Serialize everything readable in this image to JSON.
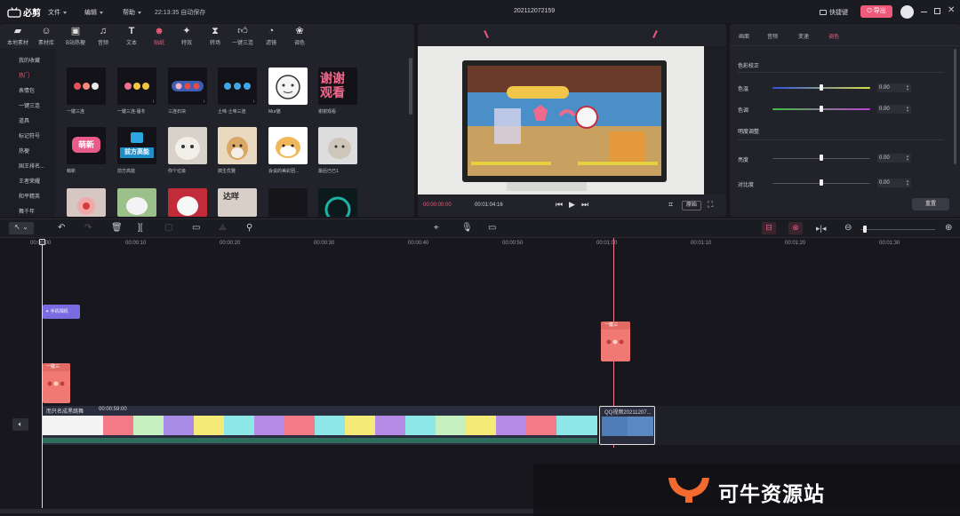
{
  "app": {
    "logo_text": "必剪",
    "title": "202112072159",
    "autosave": "22:13:35 自动保存",
    "shortcut": "快捷键",
    "export": "导出"
  },
  "menu": [
    {
      "label": "文件"
    },
    {
      "label": "编辑"
    },
    {
      "label": "帮助"
    }
  ],
  "tabs": [
    {
      "label": "本地素材",
      "icon": "folder-icon"
    },
    {
      "label": "素材库",
      "icon": "smile-icon"
    },
    {
      "label": "B站热梗",
      "icon": "tv-icon"
    },
    {
      "label": "音频",
      "icon": "music-icon"
    },
    {
      "label": "文本",
      "icon": "text-icon"
    },
    {
      "label": "贴纸",
      "icon": "sticker-icon"
    },
    {
      "label": "特效",
      "icon": "sparkle-icon"
    },
    {
      "label": "转场",
      "icon": "transition-icon"
    },
    {
      "label": "一键三连",
      "icon": "thumb-icon"
    },
    {
      "label": "滤镜",
      "icon": "filter-icon"
    },
    {
      "label": "调色",
      "icon": "color-icon"
    }
  ],
  "categories": [
    {
      "label": "我的收藏"
    },
    {
      "label": "热门"
    },
    {
      "label": "表情包"
    },
    {
      "label": "一键三连"
    },
    {
      "label": "道具"
    },
    {
      "label": "标记符号"
    },
    {
      "label": "热梗"
    },
    {
      "label": "国王排名..."
    },
    {
      "label": "王者荣耀"
    },
    {
      "label": "和平精英"
    },
    {
      "label": "舞千年"
    }
  ],
  "stickers": [
    {
      "label": "一键三连"
    },
    {
      "label": "一键三连-履冬"
    },
    {
      "label": "三连石块"
    },
    {
      "label": "土味-土味三连"
    },
    {
      "label": "Mur猫"
    },
    {
      "label": "谢谢观看"
    },
    {
      "label": "萌新"
    },
    {
      "label": "前方高能"
    },
    {
      "label": "你个垃圾"
    },
    {
      "label": "搞生优雅"
    },
    {
      "label": "会说的美彩团..."
    },
    {
      "label": "最后已已1"
    },
    {
      "label": ""
    },
    {
      "label": ""
    },
    {
      "label": ""
    },
    {
      "label": ""
    },
    {
      "label": ""
    },
    {
      "label": ""
    }
  ],
  "sticker_texts": {
    "thanks_line1": "谢谢",
    "thanks_line2": "观看",
    "cute": "萌新",
    "high": "前方高能",
    "dash": "达咩"
  },
  "preview": {
    "current_time": "00:00:00:00",
    "total_time": "00:01:04:16",
    "ratio_button": "原始"
  },
  "props": {
    "tabs": [
      {
        "label": "画面"
      },
      {
        "label": "音频"
      },
      {
        "label": "变速"
      },
      {
        "label": "调色"
      }
    ],
    "section1": "色彩校正",
    "section2": "明度调整",
    "rows": [
      {
        "label": "色温",
        "value": "0.00"
      },
      {
        "label": "色调",
        "value": "0.00"
      },
      {
        "label": "亮度",
        "value": "0.00"
      },
      {
        "label": "对比度",
        "value": "0.00"
      }
    ],
    "reset": "重置"
  },
  "timeline": {
    "ruler": [
      "00:00:00",
      "00:00:10",
      "00:00:20",
      "00:00:30",
      "00:00:40",
      "00:00:50",
      "00:01:00",
      "00:01:10",
      "00:01:20",
      "00:01:30"
    ],
    "effect_clip": "手机相机",
    "sticker_clip_1": "一键三",
    "sticker_clip_2": "一键三",
    "main_clip_title": "而只名成黑跳舞",
    "main_clip_duration": "00:00:59:00",
    "second_clip_title": "QQ视频20211207..."
  },
  "watermark": {
    "text": "可牛资源站"
  },
  "colors": {
    "accent": "#ee5b7a",
    "effect_clip": "#7b6be0",
    "sticker_clip": "#f07a73"
  }
}
